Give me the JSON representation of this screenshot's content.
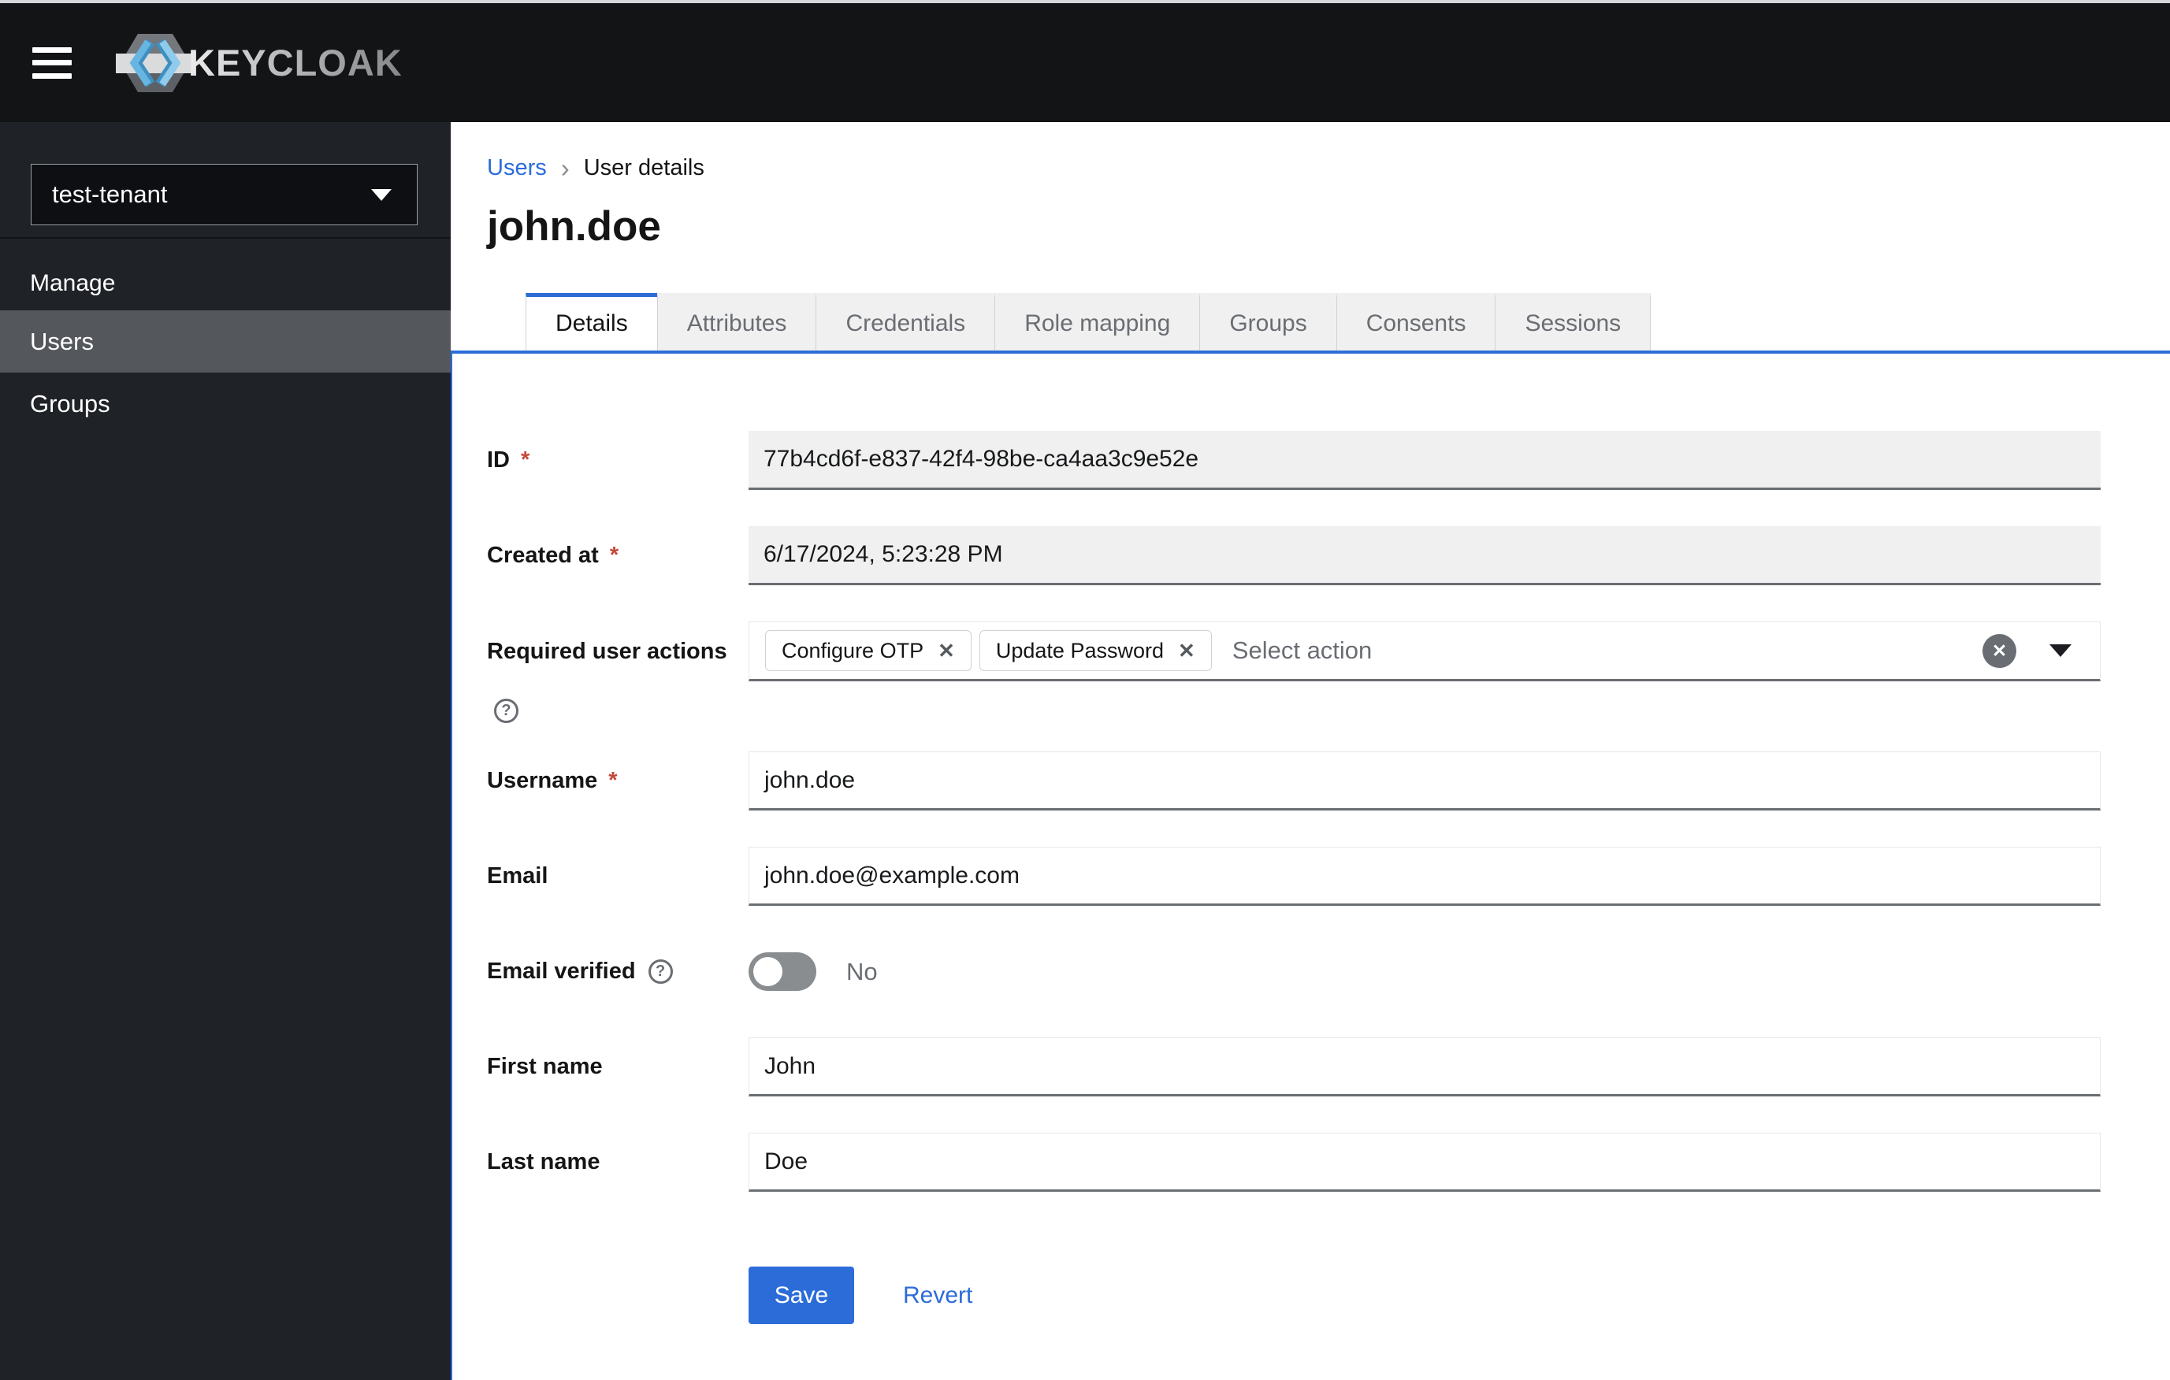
{
  "header": {
    "brand": "KEYCLOAK"
  },
  "sidebar": {
    "tenant_selector": {
      "value": "test-tenant"
    },
    "section_label": "Manage",
    "items": [
      {
        "label": "Users",
        "active": true
      },
      {
        "label": "Groups",
        "active": false
      }
    ]
  },
  "breadcrumb": {
    "items": [
      {
        "label": "Users",
        "link": true
      },
      {
        "label": "User details",
        "link": false
      }
    ]
  },
  "page": {
    "title": "john.doe"
  },
  "tabs": [
    {
      "label": "Details",
      "active": true
    },
    {
      "label": "Attributes",
      "active": false
    },
    {
      "label": "Credentials",
      "active": false
    },
    {
      "label": "Role mapping",
      "active": false
    },
    {
      "label": "Groups",
      "active": false
    },
    {
      "label": "Consents",
      "active": false
    },
    {
      "label": "Sessions",
      "active": false
    }
  ],
  "form": {
    "required_marker": "*",
    "fields": {
      "id": {
        "label": "ID",
        "required": true,
        "disabled": true,
        "value": "77b4cd6f-e837-42f4-98be-ca4aa3c9e52e"
      },
      "created_at": {
        "label": "Created at",
        "required": true,
        "disabled": true,
        "value": "6/17/2024, 5:23:28 PM"
      },
      "required_user_actions": {
        "label": "Required user actions",
        "has_help": true,
        "chips": [
          "Configure OTP",
          "Update Password"
        ],
        "placeholder": "Select action"
      },
      "username": {
        "label": "Username",
        "required": true,
        "value": "john.doe"
      },
      "email": {
        "label": "Email",
        "value": "john.doe@example.com"
      },
      "email_verified": {
        "label": "Email verified",
        "has_help": true,
        "state": "No",
        "enabled": false
      },
      "first_name": {
        "label": "First name",
        "value": "John"
      },
      "last_name": {
        "label": "Last name",
        "value": "Doe"
      }
    },
    "actions": {
      "save": "Save",
      "revert": "Revert"
    }
  },
  "icons": {
    "close_glyph": "✕",
    "help_glyph": "?",
    "breadcrumb_separator": "›"
  },
  "colors": {
    "accent": "#2b6cd9",
    "danger_asterisk": "#c4483a",
    "header_bg": "#131416",
    "sidebar_bg": "#1f2226",
    "nav_active_bg": "#54575b",
    "tab_inactive_bg": "#f0f0f0",
    "disabled_field_bg": "#f0f0f0",
    "field_bottom_border": "#6a6e73",
    "muted_text": "#6a6e73",
    "logo_blue": "#56aede"
  }
}
